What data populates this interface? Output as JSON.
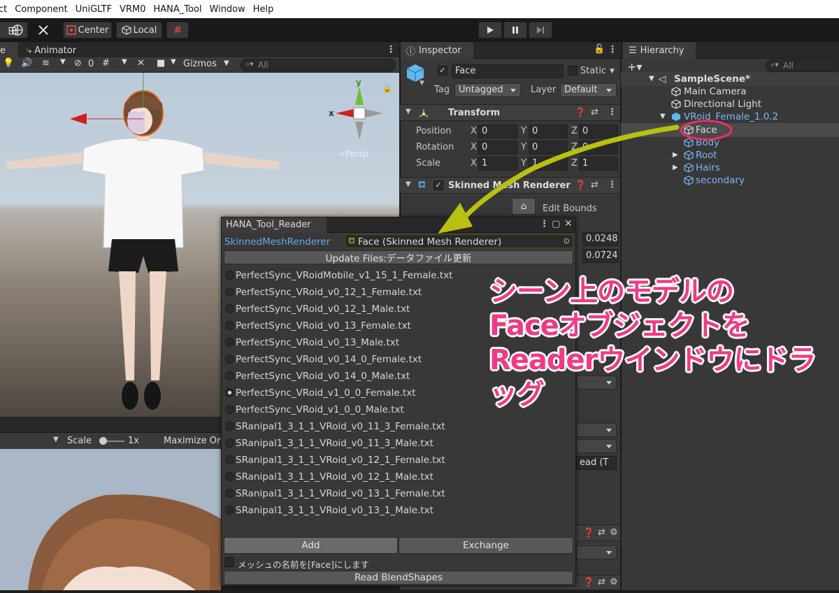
{
  "menubar": {
    "items": [
      "ct",
      "Component",
      "UniGLTF",
      "VRM0",
      "HANA_Tool",
      "Window",
      "Help"
    ]
  },
  "toolbar": {
    "center_label": "Center",
    "local_label": "Local"
  },
  "scene_panel": {
    "tab_partial": "e",
    "animator_tab": "Animator",
    "layers_count": "0",
    "gizmos_label": "Gizmos",
    "search_placeholder": "All",
    "persp_label": "<Persp",
    "axis_x": "x",
    "axis_y": "y"
  },
  "game_panel": {
    "scale_label": "Scale",
    "scale_value": "1x",
    "maximize_label": "Maximize On"
  },
  "inspector": {
    "tab": "Inspector",
    "object_name": "Face",
    "static_label": "Static",
    "tag_label": "Tag",
    "tag_value": "Untagged",
    "layer_label": "Layer",
    "layer_value": "Default",
    "transform": {
      "title": "Transform",
      "rows": [
        {
          "label": "Position",
          "x": "0",
          "y": "0",
          "z": "0"
        },
        {
          "label": "Rotation",
          "x": "0",
          "y": "0",
          "z": "0"
        },
        {
          "label": "Scale",
          "x": "1",
          "y": "1",
          "z": "1"
        }
      ],
      "x": "X",
      "y": "Y",
      "z": "Z"
    },
    "smr": {
      "title": "Skinned Mesh Renderer",
      "edit_bounds": "Edit Bounds",
      "val1": "0.0248",
      "val2": "0.0724",
      "partial": "ead (T"
    }
  },
  "hierarchy": {
    "tab": "Hierarchy",
    "search_placeholder": "All",
    "items": [
      {
        "label": "SampleScene*",
        "kind": "scene"
      },
      {
        "label": "Main Camera",
        "kind": "object"
      },
      {
        "label": "Directional Light",
        "kind": "object"
      },
      {
        "label": "VRoid_Female_1.0.2",
        "kind": "prefab"
      },
      {
        "label": "Face",
        "kind": "child"
      },
      {
        "label": "Body",
        "kind": "child"
      },
      {
        "label": "Root",
        "kind": "child"
      },
      {
        "label": "Hairs",
        "kind": "child"
      },
      {
        "label": "secondary",
        "kind": "child"
      }
    ]
  },
  "reader": {
    "title": "HANA_Tool_Reader",
    "smr_label": "SkinnedMeshRenderer",
    "smr_value": "Face (Skinned Mesh Renderer)",
    "update_button": "Update Files:データファイル更新",
    "files": [
      "PerfectSync_VRoidMobile_v1_15_1_Female.txt",
      "PerfectSync_VRoid_v0_12_1_Female.txt",
      "PerfectSync_VRoid_v0_12_1_Male.txt",
      "PerfectSync_VRoid_v0_13_Female.txt",
      "PerfectSync_VRoid_v0_13_Male.txt",
      "PerfectSync_VRoid_v0_14_0_Female.txt",
      "PerfectSync_VRoid_v0_14_0_Male.txt",
      "PerfectSync_VRoid_v1_0_0_Female.txt",
      "PerfectSync_VRoid_v1_0_0_Male.txt",
      "SRanipal1_3_1_1_VRoid_v0_11_3_Female.txt",
      "SRanipal1_3_1_1_VRoid_v0_11_3_Male.txt",
      "SRanipal1_3_1_1_VRoid_v0_12_1_Female.txt",
      "SRanipal1_3_1_1_VRoid_v0_12_1_Male.txt",
      "SRanipal1_3_1_1_VRoid_v0_13_1_Female.txt",
      "SRanipal1_3_1_1_VRoid_v0_13_1_Male.txt"
    ],
    "selected_index": 7,
    "add_label": "Add",
    "exchange_label": "Exchange",
    "rename_label": "メッシュの名前を[Face]にします",
    "read_button": "Read BlendShapes"
  },
  "annotation": {
    "lines": [
      "シーン上のモデルの",
      "Faceオブジェクトを",
      "Readerウインドウにドラッグ"
    ]
  },
  "colors": {
    "accent_pink": "#f03a86",
    "arrow_yellow": "#b8c010",
    "prefab_blue": "#7ab8f5",
    "circle_pink": "#ee2f6a"
  }
}
